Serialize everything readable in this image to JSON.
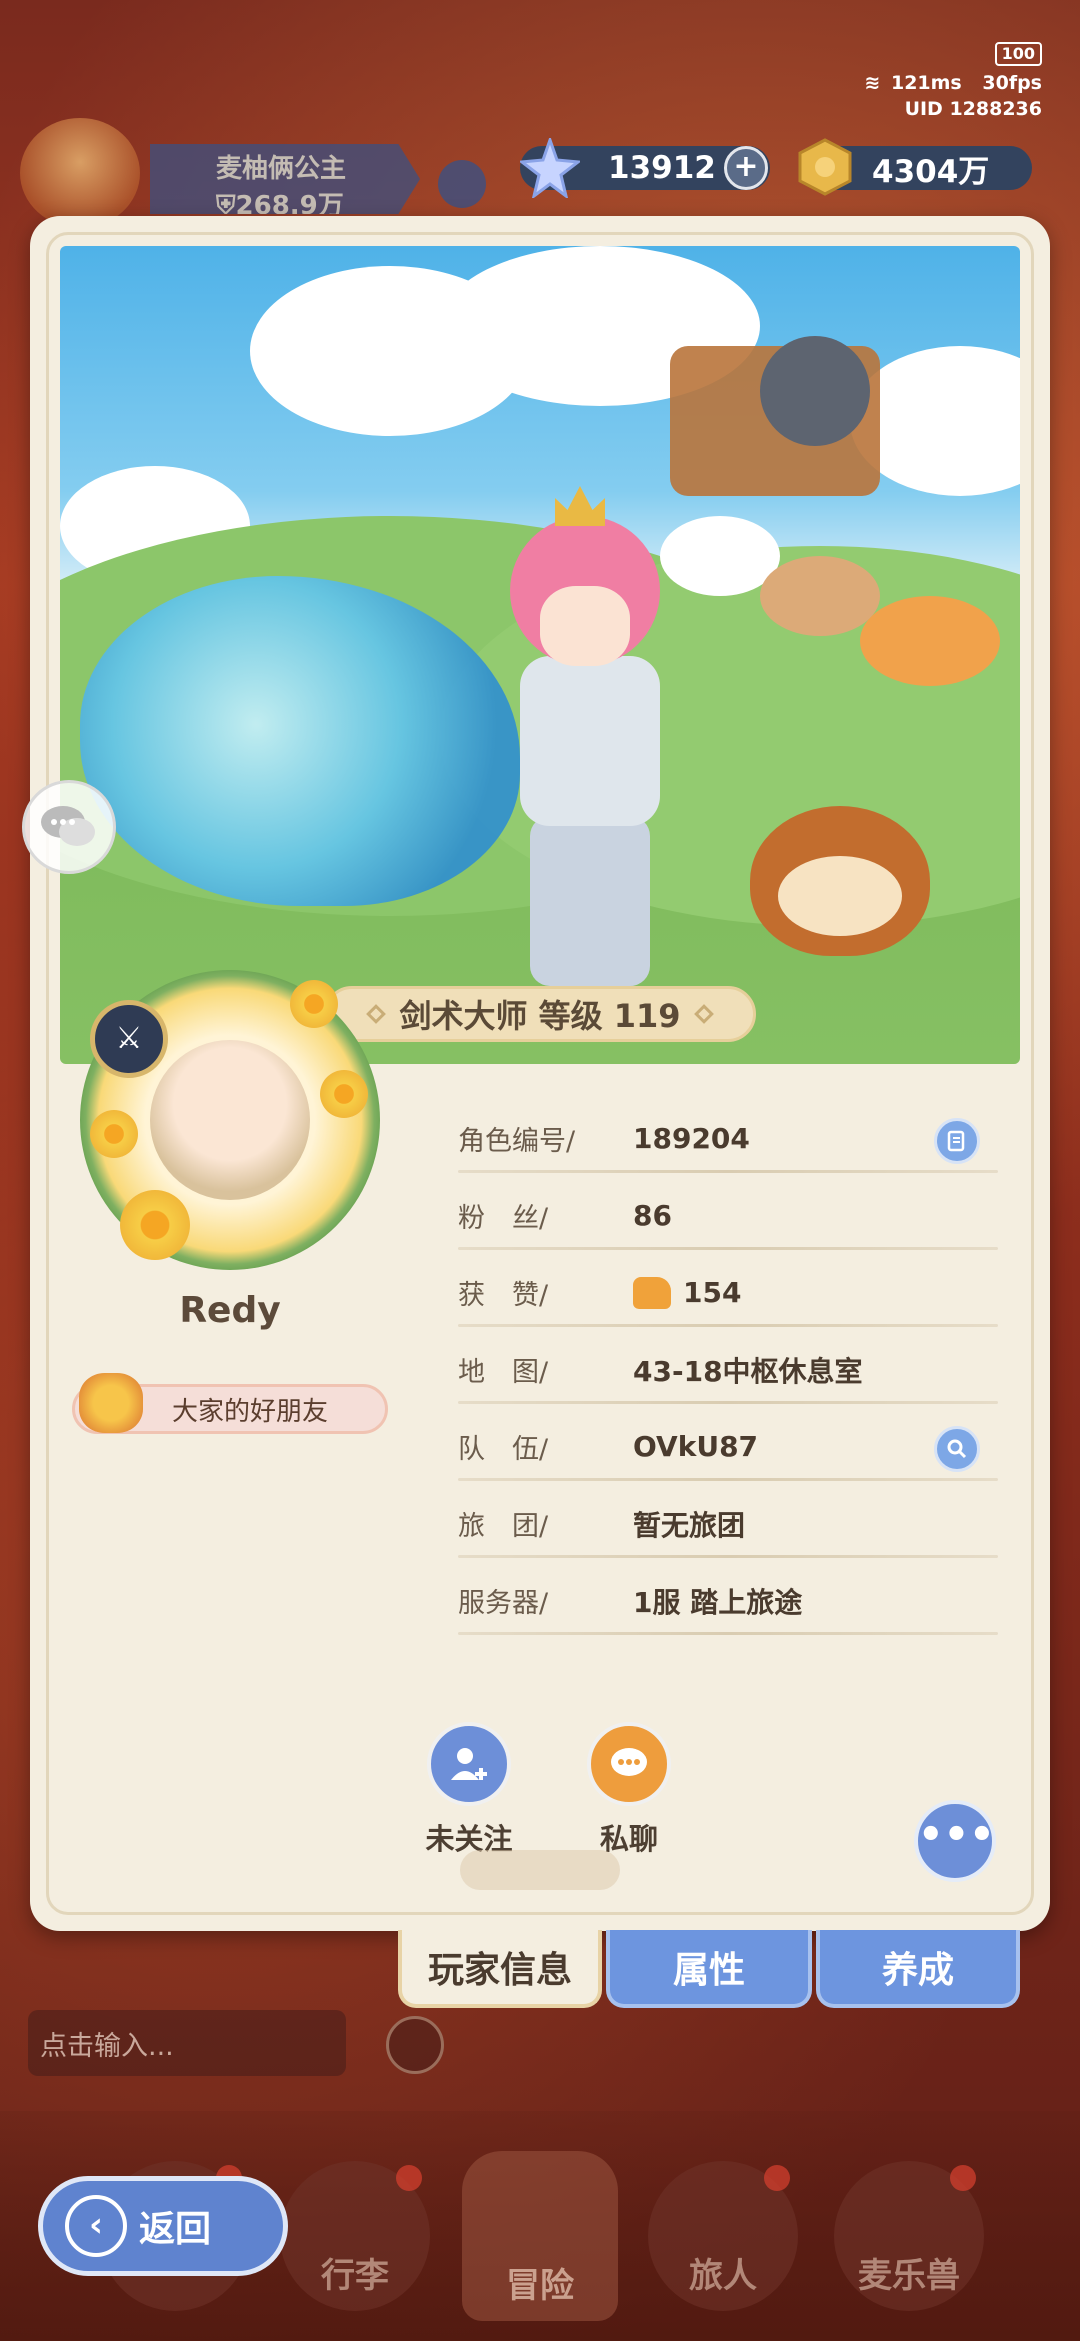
{
  "status": {
    "battery": "100",
    "ping": "121ms",
    "fps": "30fps",
    "uid": "UID 1288236"
  },
  "guild": {
    "name": "麦柚俩公主",
    "power": "268.9万"
  },
  "resources": {
    "gems": "13912",
    "gold": "4304万"
  },
  "profile": {
    "class_level": "剑术大师 等级 119",
    "player_name": "Redy",
    "title": "大家的好朋友",
    "fields": [
      {
        "label": "角色编号/",
        "value": "189204"
      },
      {
        "label": "粉　丝/",
        "value": "86"
      },
      {
        "label": "获　赞/",
        "value": "154"
      },
      {
        "label": "地　图/",
        "value": "43-18中枢休息室"
      },
      {
        "label": "队　伍/",
        "value": "OVkU87"
      },
      {
        "label": "旅　团/",
        "value": "暂无旅团"
      },
      {
        "label": "服务器/",
        "value": "1服  踏上旅途"
      }
    ]
  },
  "actions": {
    "follow": "未关注",
    "private_chat": "私聊"
  },
  "tabs": {
    "player_info": "玩家信息",
    "attributes": "属性",
    "cultivate": "养成"
  },
  "chat": {
    "placeholder": "点击输入..."
  },
  "nav": {
    "luggage": "行李",
    "adventure": "冒险",
    "traveler": "旅人",
    "pets": "麦乐兽",
    "back": "返回"
  },
  "colors": {
    "accent_blue": "#6d95df",
    "card_bg": "#f4eee0",
    "text_brown": "#4a3b2e"
  }
}
